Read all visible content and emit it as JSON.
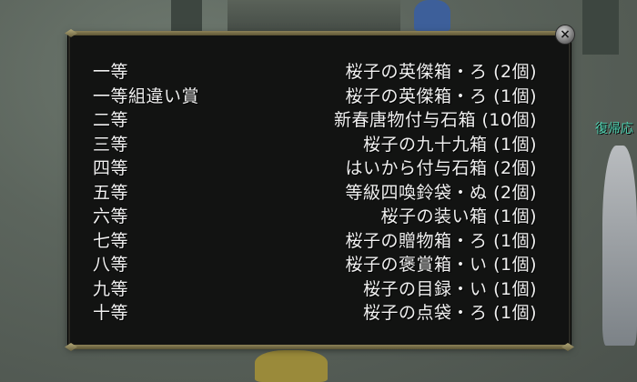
{
  "close_icon": "×",
  "side_label": "復帰応",
  "prizes": [
    {
      "rank": "一等",
      "prize": "桜子の英傑箱・ろ (2個)"
    },
    {
      "rank": "一等組違い賞",
      "prize": "桜子の英傑箱・ろ (1個)"
    },
    {
      "rank": "二等",
      "prize": "新春唐物付与石箱 (10個)"
    },
    {
      "rank": "三等",
      "prize": "桜子の九十九箱 (1個)"
    },
    {
      "rank": "四等",
      "prize": "はいから付与石箱 (2個)"
    },
    {
      "rank": "五等",
      "prize": "等級四喚鈴袋・ぬ (2個)"
    },
    {
      "rank": "六等",
      "prize": "桜子の装い箱 (1個)"
    },
    {
      "rank": "七等",
      "prize": "桜子の贈物箱・ろ (1個)"
    },
    {
      "rank": "八等",
      "prize": "桜子の褒賞箱・い (1個)"
    },
    {
      "rank": "九等",
      "prize": "桜子の目録・い (1個)"
    },
    {
      "rank": "十等",
      "prize": "桜子の点袋・ろ (1個)"
    }
  ]
}
